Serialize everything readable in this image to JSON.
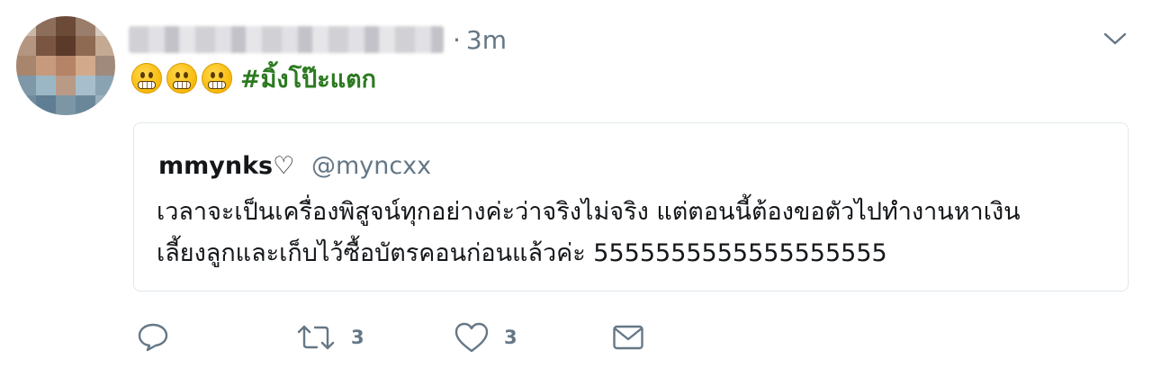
{
  "tweet": {
    "timestamp": "3m",
    "separator": "·",
    "hashtag": "#มิ้งโป๊ะแตก",
    "emoji": [
      "grimacing-face",
      "grimacing-face",
      "grimacing-face"
    ]
  },
  "quote": {
    "name": "mmynks",
    "heart": "♡",
    "handle": "@myncxx",
    "line1": "เวลาจะเป็นเครื่องพิสูจน์ทุกอย่างค่ะว่าจริงไม่จริง แต่ตอนนี้ต้องขอตัวไปทำงานหาเงิน",
    "line2": "เลี้ยงลูกและเก็บไว้ซื้อบัตรคอนก่อนแล้วค่ะ 5555555555555555555"
  },
  "actions": {
    "reply_icon": "reply-icon",
    "retweet_icon": "retweet-icon",
    "retweet_count": "3",
    "like_icon": "heart-icon",
    "like_count": "3",
    "dm_icon": "envelope-icon"
  },
  "colors": {
    "hashtag": "#2b7a1f",
    "muted": "#657786",
    "border": "#e1e8ed"
  }
}
